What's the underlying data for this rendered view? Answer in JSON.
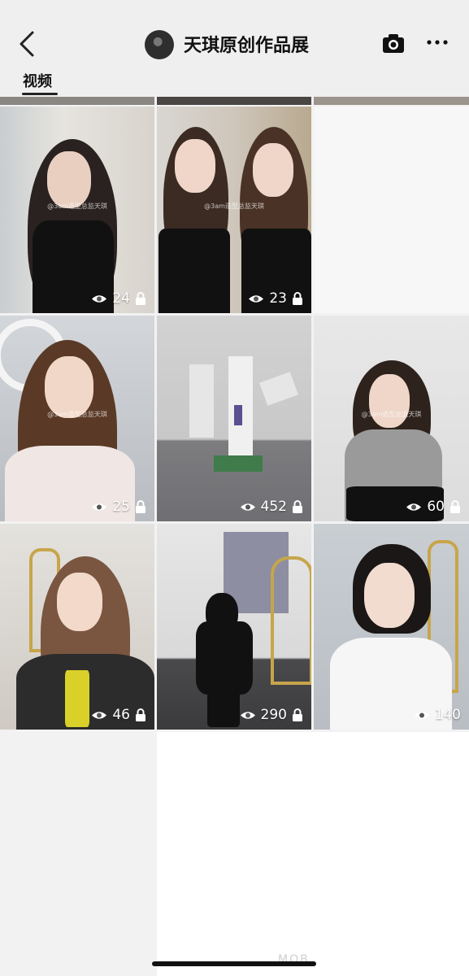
{
  "header": {
    "title": "天琪原创作品展",
    "icons": {
      "back": "chevron-left-icon",
      "camera": "camera-icon",
      "more": "more-dots-icon"
    }
  },
  "tabs": [
    {
      "label": "视频",
      "active": true
    }
  ],
  "videos": [
    {
      "views": "24",
      "locked": true,
      "watermark": "@3am造型总监天琪"
    },
    {
      "views": "23",
      "locked": true,
      "watermark": "@3am造型总监天琪"
    },
    {
      "views": "25",
      "locked": true,
      "watermark": "@3am造型总监天琪"
    },
    {
      "views": "452",
      "locked": true,
      "watermark": ""
    },
    {
      "views": "60",
      "locked": true,
      "watermark": "@3am造型总监天琪"
    },
    {
      "views": "46",
      "locked": true,
      "watermark": ""
    },
    {
      "views": "290",
      "locked": true,
      "watermark": ""
    },
    {
      "views": "140",
      "locked": false,
      "watermark": ""
    }
  ],
  "footer": {
    "corner_text": "MOB"
  }
}
